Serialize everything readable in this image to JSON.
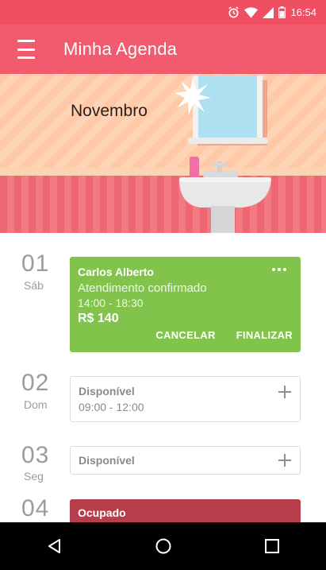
{
  "status_bar": {
    "time": "16:54",
    "icons": [
      "alarm-icon",
      "wifi-icon",
      "signal-icon",
      "battery-icon"
    ]
  },
  "app_bar": {
    "title": "Minha Agenda",
    "menu_icon": "hamburger-menu-icon"
  },
  "banner": {
    "month": "Novembro"
  },
  "agenda": [
    {
      "day_number": "01",
      "day_name": "Sáb",
      "card": {
        "type": "confirmed",
        "client": "Carlos Alberto",
        "status": "Atendimento confirmado",
        "time": "14:00 - 18:30",
        "price": "R$ 140",
        "actions": [
          "CANCELAR",
          "FINALIZAR"
        ]
      }
    },
    {
      "day_number": "02",
      "day_name": "Dom",
      "card": {
        "type": "available",
        "label": "Disponível",
        "time": "09:00 - 12:00"
      }
    },
    {
      "day_number": "03",
      "day_name": "Seg",
      "card": {
        "type": "available",
        "label": "Disponível"
      }
    },
    {
      "day_number": "04",
      "day_name": "",
      "card": {
        "type": "busy",
        "label": "Ocupado"
      }
    }
  ],
  "colors": {
    "status_bar": "#f04f62",
    "app_bar": "#f25a6e",
    "confirmed": "#82c34c",
    "busy": "#b73c4c"
  },
  "nav_bar": [
    "back-icon",
    "home-icon",
    "recents-icon"
  ]
}
